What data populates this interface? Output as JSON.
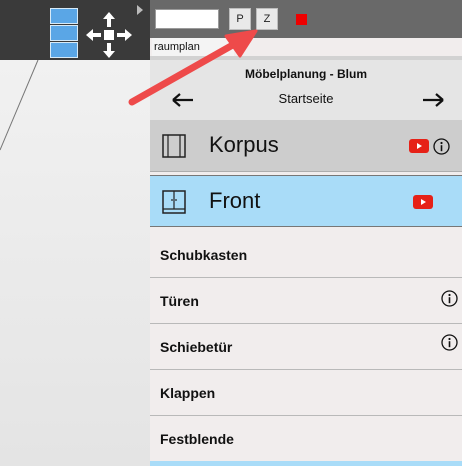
{
  "toolbar": {
    "input_value": "",
    "p_label": "P",
    "z_label": "Z",
    "tab_label": "raumplan"
  },
  "header": {
    "title": "Möbelplanung - Blum",
    "subtitle": "Startseite"
  },
  "menu": {
    "big_items": [
      {
        "label": "Korpus",
        "icon": "cabinet-icon",
        "has_video": true,
        "has_info": true
      },
      {
        "label": "Front",
        "icon": "front-door-icon",
        "has_video": true,
        "has_info": false
      }
    ],
    "items": [
      {
        "label": "Schubkasten",
        "has_info": false
      },
      {
        "label": "Türen",
        "has_info": true
      },
      {
        "label": "Schiebetür",
        "has_info": true
      },
      {
        "label": "Klappen",
        "has_info": false
      },
      {
        "label": "Festblende",
        "has_info": false
      }
    ]
  },
  "colors": {
    "accent_selected": "#a9dcf8",
    "toolbar_dark": "#3a3a3a",
    "topbar": "#696969",
    "video_red": "#e62117",
    "annotation_arrow": "#ee4a4a"
  }
}
